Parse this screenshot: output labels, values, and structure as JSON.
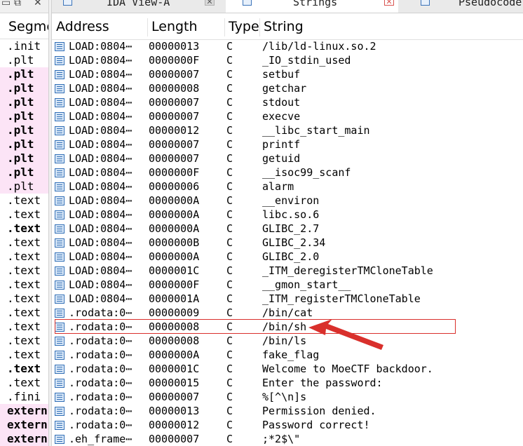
{
  "left_panel": {
    "header": "Segment",
    "segments": [
      {
        "name": ".init",
        "style": "plain"
      },
      {
        "name": ".plt",
        "style": "plain"
      },
      {
        "name": ".plt",
        "style": "pink-bold"
      },
      {
        "name": ".plt",
        "style": "pink-bold"
      },
      {
        "name": ".plt",
        "style": "pink-bold"
      },
      {
        "name": ".plt",
        "style": "pink-bold"
      },
      {
        "name": ".plt",
        "style": "pink-bold"
      },
      {
        "name": ".plt",
        "style": "pink-bold"
      },
      {
        "name": ".plt",
        "style": "pink-bold"
      },
      {
        "name": ".plt",
        "style": "pink-bold"
      },
      {
        "name": ".plt",
        "style": "pink"
      },
      {
        "name": ".text",
        "style": "plain"
      },
      {
        "name": ".text",
        "style": "plain"
      },
      {
        "name": ".text",
        "style": "bold"
      },
      {
        "name": ".text",
        "style": "plain"
      },
      {
        "name": ".text",
        "style": "plain"
      },
      {
        "name": ".text",
        "style": "plain"
      },
      {
        "name": ".text",
        "style": "plain"
      },
      {
        "name": ".text",
        "style": "plain"
      },
      {
        "name": ".text",
        "style": "plain"
      },
      {
        "name": ".text",
        "style": "plain"
      },
      {
        "name": ".text",
        "style": "plain"
      },
      {
        "name": ".text",
        "style": "plain"
      },
      {
        "name": ".text",
        "style": "bold"
      },
      {
        "name": ".text",
        "style": "plain"
      },
      {
        "name": ".fini",
        "style": "plain"
      },
      {
        "name": "extern",
        "style": "pink-bold"
      },
      {
        "name": "extern",
        "style": "pink-bold"
      },
      {
        "name": "extern",
        "style": "pink-bold"
      }
    ]
  },
  "tabs": [
    {
      "label": "IDA View-A",
      "active": false,
      "close": "grey"
    },
    {
      "label": "Strings",
      "active": true,
      "close": "red"
    },
    {
      "label": "Pseudocode-",
      "active": false,
      "close": ""
    }
  ],
  "table": {
    "columns": [
      "Address",
      "Length",
      "Type",
      "String"
    ],
    "rows": [
      {
        "address": "LOAD:0804⋯",
        "length": "00000013",
        "type": "C",
        "string": "/lib/ld-linux.so.2"
      },
      {
        "address": "LOAD:0804⋯",
        "length": "0000000F",
        "type": "C",
        "string": "_IO_stdin_used"
      },
      {
        "address": "LOAD:0804⋯",
        "length": "00000007",
        "type": "C",
        "string": "setbuf"
      },
      {
        "address": "LOAD:0804⋯",
        "length": "00000008",
        "type": "C",
        "string": "getchar"
      },
      {
        "address": "LOAD:0804⋯",
        "length": "00000007",
        "type": "C",
        "string": "stdout"
      },
      {
        "address": "LOAD:0804⋯",
        "length": "00000007",
        "type": "C",
        "string": "execve"
      },
      {
        "address": "LOAD:0804⋯",
        "length": "00000012",
        "type": "C",
        "string": "__libc_start_main"
      },
      {
        "address": "LOAD:0804⋯",
        "length": "00000007",
        "type": "C",
        "string": "printf"
      },
      {
        "address": "LOAD:0804⋯",
        "length": "00000007",
        "type": "C",
        "string": "getuid"
      },
      {
        "address": "LOAD:0804⋯",
        "length": "0000000F",
        "type": "C",
        "string": "__isoc99_scanf"
      },
      {
        "address": "LOAD:0804⋯",
        "length": "00000006",
        "type": "C",
        "string": "alarm"
      },
      {
        "address": "LOAD:0804⋯",
        "length": "0000000A",
        "type": "C",
        "string": "__environ"
      },
      {
        "address": "LOAD:0804⋯",
        "length": "0000000A",
        "type": "C",
        "string": "libc.so.6"
      },
      {
        "address": "LOAD:0804⋯",
        "length": "0000000A",
        "type": "C",
        "string": "GLIBC_2.7"
      },
      {
        "address": "LOAD:0804⋯",
        "length": "0000000B",
        "type": "C",
        "string": "GLIBC_2.34"
      },
      {
        "address": "LOAD:0804⋯",
        "length": "0000000A",
        "type": "C",
        "string": "GLIBC_2.0"
      },
      {
        "address": "LOAD:0804⋯",
        "length": "0000001C",
        "type": "C",
        "string": "_ITM_deregisterTMCloneTable"
      },
      {
        "address": "LOAD:0804⋯",
        "length": "0000000F",
        "type": "C",
        "string": "__gmon_start__"
      },
      {
        "address": "LOAD:0804⋯",
        "length": "0000001A",
        "type": "C",
        "string": "_ITM_registerTMCloneTable"
      },
      {
        "address": ".rodata:0⋯",
        "length": "00000009",
        "type": "C",
        "string": "/bin/cat"
      },
      {
        "address": ".rodata:0⋯",
        "length": "00000008",
        "type": "C",
        "string": "/bin/sh"
      },
      {
        "address": ".rodata:0⋯",
        "length": "00000008",
        "type": "C",
        "string": "/bin/ls"
      },
      {
        "address": ".rodata:0⋯",
        "length": "0000000A",
        "type": "C",
        "string": "fake_flag"
      },
      {
        "address": ".rodata:0⋯",
        "length": "0000001C",
        "type": "C",
        "string": "Welcome to MoeCTF backdoor."
      },
      {
        "address": ".rodata:0⋯",
        "length": "00000015",
        "type": "C",
        "string": "Enter the password:"
      },
      {
        "address": ".rodata:0⋯",
        "length": "00000007",
        "type": "C",
        "string": "%[^\\n]s"
      },
      {
        "address": ".rodata:0⋯",
        "length": "00000013",
        "type": "C",
        "string": "Permission denied."
      },
      {
        "address": ".rodata:0⋯",
        "length": "00000012",
        "type": "C",
        "string": "Password correct!"
      },
      {
        "address": ".eh_frame⋯",
        "length": "00000007",
        "type": "C",
        "string": ";*2$\\\""
      }
    ]
  },
  "annotation": {
    "highlighted_row": 20,
    "color": "#d9302c"
  },
  "colors": {
    "segment_highlight": "#fce4f6",
    "icon_blue": "#2f6db5"
  }
}
